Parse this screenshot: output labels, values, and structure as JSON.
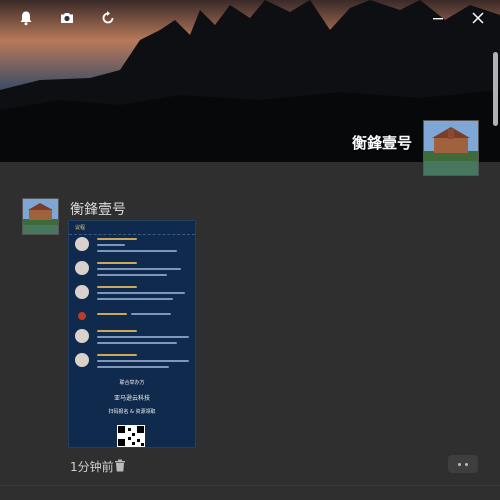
{
  "toolbar": {
    "icons": [
      "bell-icon",
      "camera-icon",
      "refresh-icon",
      "minimize-icon",
      "close-icon"
    ]
  },
  "profile": {
    "name": "衡鋒壹号"
  },
  "post": {
    "author": "衡鋒壹号",
    "time": "1分钟前",
    "image": {
      "header": "议程",
      "sections": [
        "联合举办方",
        "亚马逊云科技",
        "扫码报名 & 资源领取"
      ]
    }
  },
  "colors": {
    "background": "#2f2f2f",
    "poster_bg": "#0f2a4d",
    "poster_accent": "#e8c86a"
  }
}
